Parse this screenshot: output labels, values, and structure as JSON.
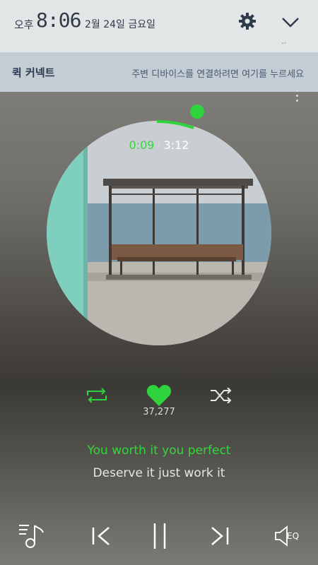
{
  "status_bar": {
    "ampm": "오후",
    "time": "8:06",
    "date": "2월 24일 금요일",
    "icon_settings": "gear-icon",
    "icon_expand": "chevron-down-icon",
    "tiny_text": "･ᵕ"
  },
  "quick_connect": {
    "title": "퀵 커넥트",
    "hint": "주변 디바이스를 연결하려면 여기를 누르세요"
  },
  "player": {
    "elapsed": "0:09",
    "separator": "·",
    "total": "3:12",
    "progress_fraction": 0.047,
    "like_count": "37,277",
    "lyric_current": "You worth it you perfect",
    "lyric_next": "Deserve it just work it",
    "eq_label": "EQ"
  },
  "colors": {
    "accent_green": "#2fd33b",
    "status_bar_bg": "#e3e6e7",
    "quick_connect_bg": "#c4cdd3"
  }
}
